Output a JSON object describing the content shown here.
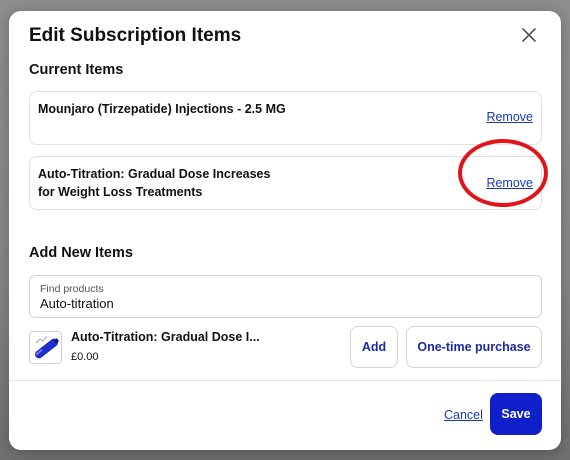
{
  "modal": {
    "title": "Edit Subscription Items",
    "close_icon": "close-icon"
  },
  "current_items": {
    "heading": "Current Items",
    "items": [
      {
        "name": "Mounjaro (Tirzepatide) Injections - 2.5 MG",
        "remove_label": "Remove"
      },
      {
        "name": "Auto-Titration: Gradual Dose Increases for Weight Loss Treatments",
        "remove_label": "Remove"
      }
    ]
  },
  "add_new": {
    "heading": "Add New Items",
    "search": {
      "label": "Find products",
      "value": "Auto-titration"
    },
    "results": [
      {
        "name": "Auto-Titration: Gradual Dose I...",
        "price": "£0.00",
        "add_label": "Add",
        "one_time_label": "One-time purchase",
        "thumbnail_icon": "syringe-pen-icon"
      }
    ]
  },
  "footer": {
    "cancel_label": "Cancel",
    "save_label": "Save"
  },
  "annotation": {
    "color": "#e1141c",
    "target": "remove-button-item-2"
  },
  "colors": {
    "primary": "#0f1fc9",
    "link": "#1a3bb8",
    "button_text": "#1c2aa3"
  }
}
